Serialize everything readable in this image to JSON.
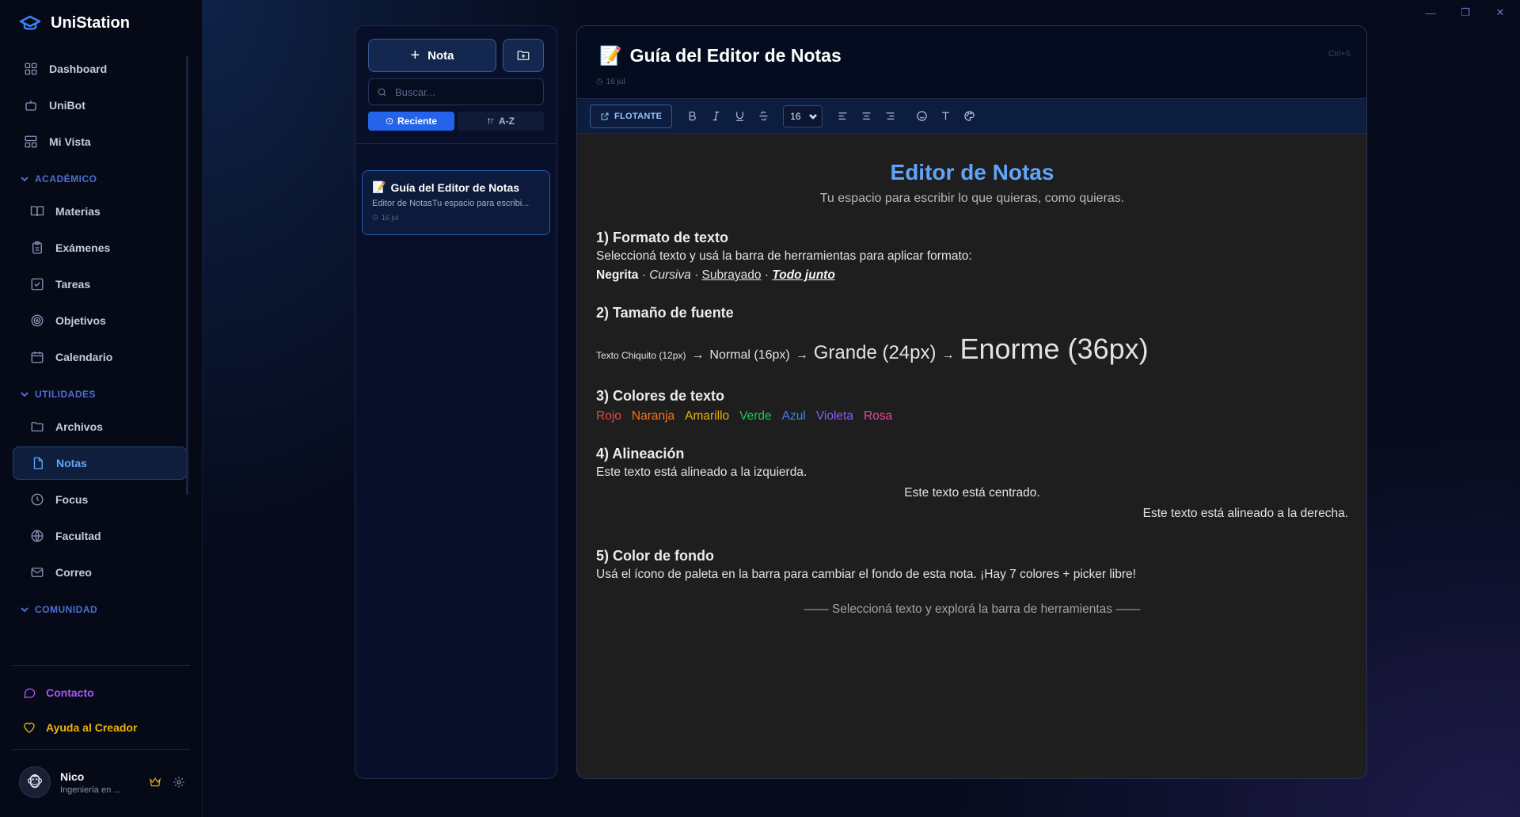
{
  "app": {
    "name": "UniStation"
  },
  "window_controls": [
    "minimize",
    "restore",
    "close"
  ],
  "sidebar": {
    "top_items": [
      {
        "label": "Dashboard",
        "icon": "dashboard-icon"
      },
      {
        "label": "UniBot",
        "icon": "bot-icon"
      },
      {
        "label": "Mi Vista",
        "icon": "layout-icon"
      }
    ],
    "sections": [
      {
        "title": "ACADÉMICO",
        "items": [
          {
            "label": "Materias",
            "icon": "book-icon"
          },
          {
            "label": "Exámenes",
            "icon": "clipboard-icon"
          },
          {
            "label": "Tareas",
            "icon": "checkbox-icon"
          },
          {
            "label": "Objetivos",
            "icon": "target-icon"
          },
          {
            "label": "Calendario",
            "icon": "calendar-icon"
          }
        ]
      },
      {
        "title": "UTILIDADES",
        "items": [
          {
            "label": "Archivos",
            "icon": "folder-icon"
          },
          {
            "label": "Notas",
            "icon": "file-icon",
            "active": true
          },
          {
            "label": "Focus",
            "icon": "clock-icon"
          },
          {
            "label": "Facultad",
            "icon": "globe-icon"
          },
          {
            "label": "Correo",
            "icon": "mail-icon"
          }
        ]
      },
      {
        "title": "COMUNIDAD",
        "items": []
      }
    ],
    "contact_label": "Contacto",
    "donate_label": "Ayuda al Creador",
    "user": {
      "name": "Nico",
      "subtitle": "Ingeniería en ..."
    }
  },
  "notes_list": {
    "new_note_label": "Nota",
    "search_placeholder": "Buscar...",
    "sort_recent_label": "Reciente",
    "sort_az_label": "A-Z",
    "items": [
      {
        "emoji": "📝",
        "title": "Guía del Editor de Notas",
        "snippet": "Editor de NotasTu espacio para escribi...",
        "date": "16 jul"
      }
    ]
  },
  "editor": {
    "emoji": "📝",
    "title": "Guía del Editor de Notas",
    "date": "16 jul",
    "shortcut": "Ctrl+S",
    "toolbar": {
      "float_label": "FLOTANTE",
      "font_size": "16"
    },
    "doc": {
      "title": "Editor de Notas",
      "subtitle": "Tu espacio para escribir lo que quieras, como quieras.",
      "s1_heading": "1) Formato de texto",
      "s1_text": "Seleccioná texto y usá la barra de herramientas para aplicar formato:",
      "s1_bold": "Negrita",
      "s1_italic": "Cursiva",
      "s1_underline": "Subrayado",
      "s1_all": "Todo junto",
      "s1_sep": "·",
      "s2_heading": "2) Tamaño de fuente",
      "s2_small": "Texto Chiquito (12px)",
      "s2_normal": "Normal (16px)",
      "s2_large": "Grande (24px)",
      "s2_huge": "Enorme (36px)",
      "s2_arrow": "→",
      "s3_heading": "3) Colores de texto",
      "s3_colors": [
        {
          "label": "Rojo",
          "color": "#ef4444"
        },
        {
          "label": "Naranja",
          "color": "#f97316"
        },
        {
          "label": "Amarillo",
          "color": "#eab308"
        },
        {
          "label": "Verde",
          "color": "#22c55e"
        },
        {
          "label": "Azul",
          "color": "#3b82f6"
        },
        {
          "label": "Violeta",
          "color": "#8b5cf6"
        },
        {
          "label": "Rosa",
          "color": "#ec4899"
        }
      ],
      "s4_heading": "4) Alineación",
      "s4_left": "Este texto está alineado a la izquierda.",
      "s4_center": "Este texto está centrado.",
      "s4_right": "Este texto está alineado a la derecha.",
      "s5_heading": "5) Color de fondo",
      "s5_text": "Usá el ícono de paleta en la barra para cambiar el fondo de esta nota. ¡Hay 7 colores + picker libre!",
      "closing": "—— Seleccioná texto y explorá la barra de herramientas ——"
    }
  },
  "colors": {
    "accent": "#3b82f6",
    "active_nav": "#60a5fa",
    "contact": "#a855f7",
    "donate": "#eab308"
  }
}
